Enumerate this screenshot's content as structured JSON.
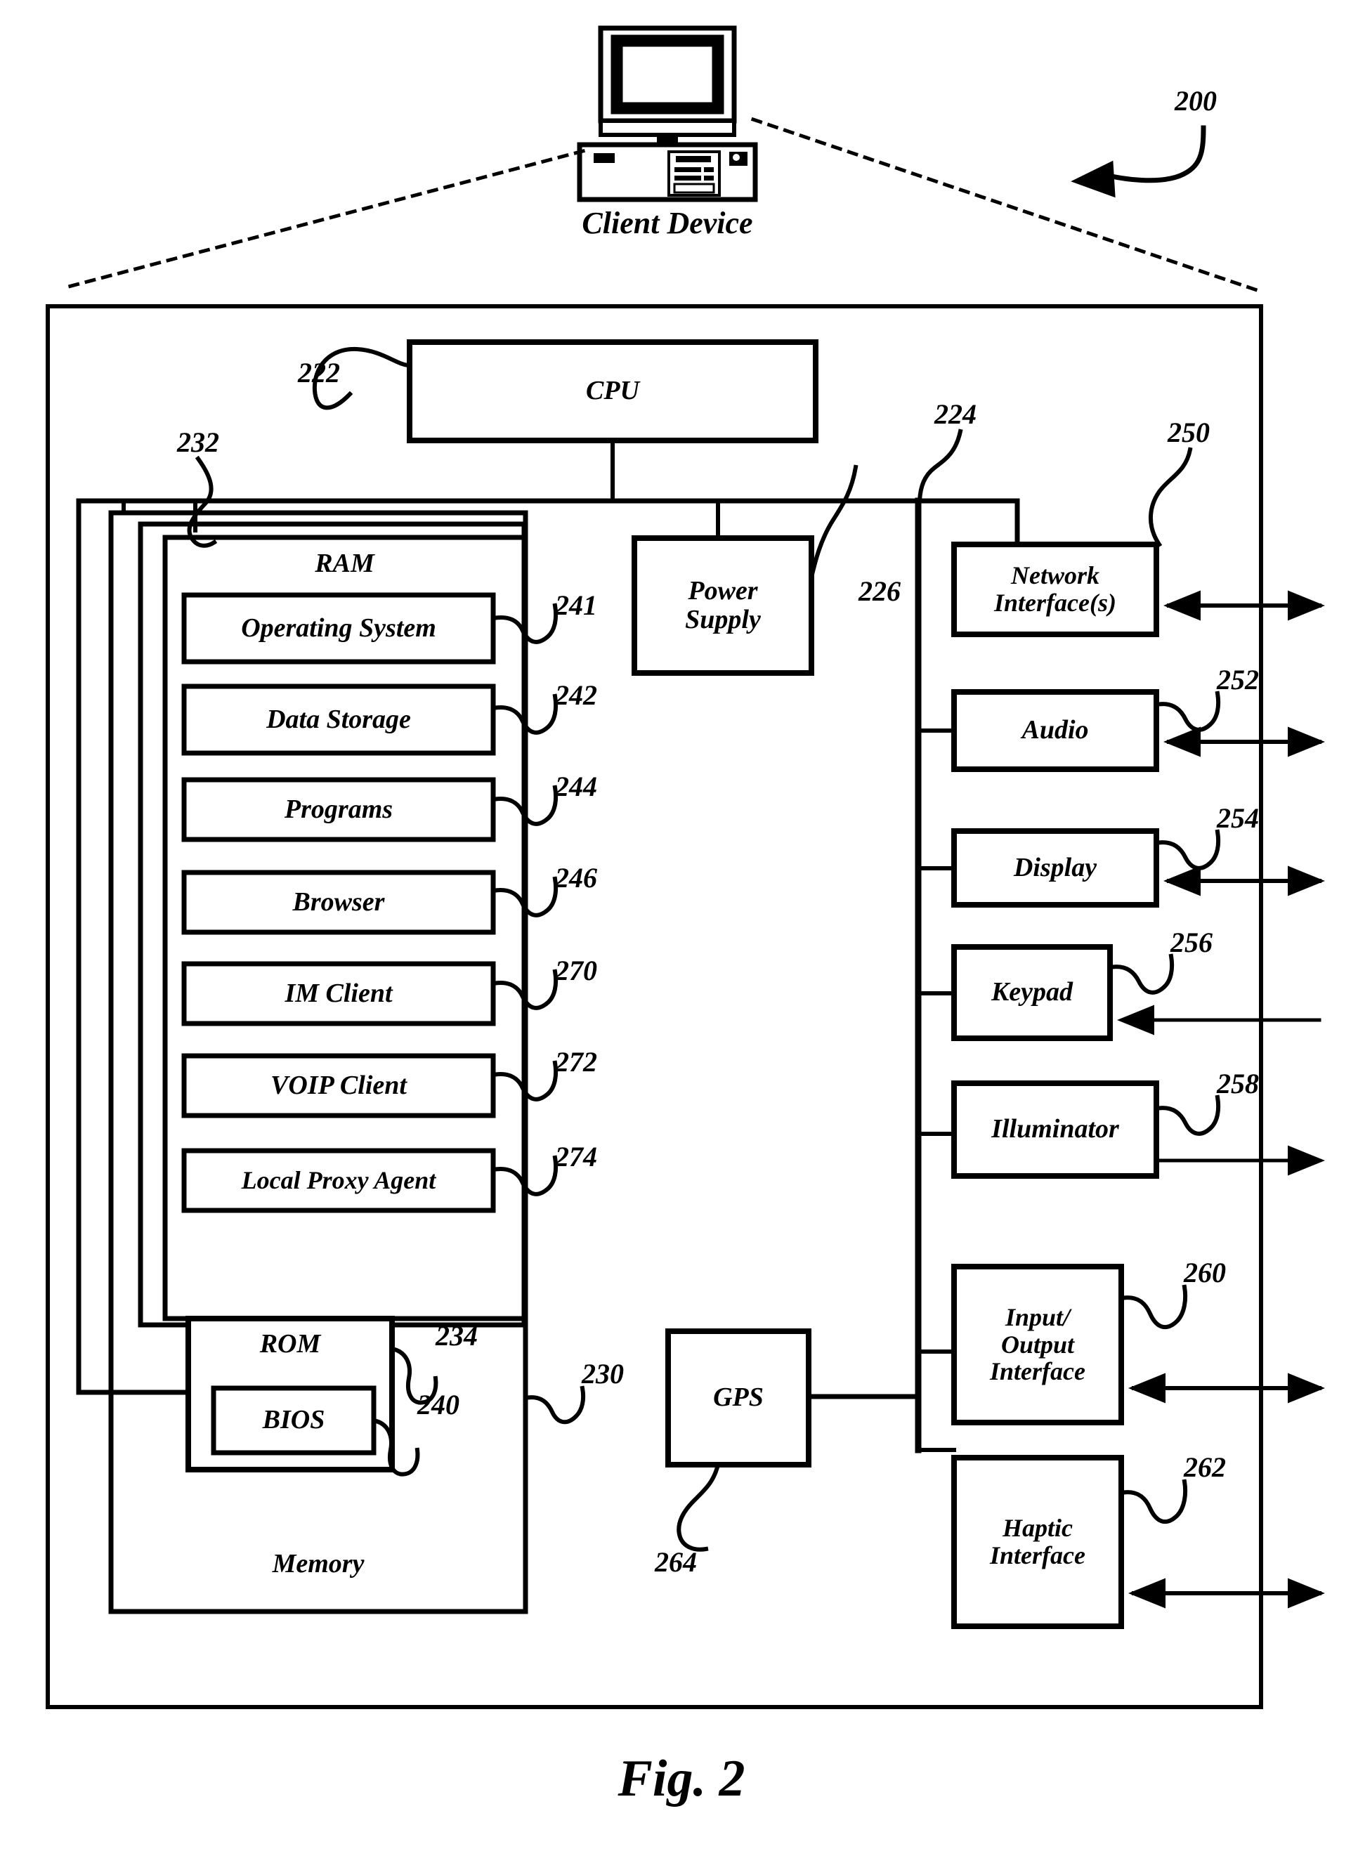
{
  "figure": {
    "caption": "Fig. 2",
    "top_label": "Client Device",
    "system_ref": "200"
  },
  "outer_frame": {
    "ref": "200"
  },
  "blocks": [
    {
      "id": "cpu",
      "label": "CPU",
      "ref": "222"
    },
    {
      "id": "memory",
      "label": "Memory",
      "ref": "230"
    },
    {
      "id": "ram",
      "label": "RAM",
      "ref": "232"
    },
    {
      "id": "os",
      "label": "Operating System",
      "ref": "241"
    },
    {
      "id": "datastore",
      "label": "Data Storage",
      "ref": "242"
    },
    {
      "id": "programs",
      "label": "Programs",
      "ref": "244"
    },
    {
      "id": "browser",
      "label": "Browser",
      "ref": "246"
    },
    {
      "id": "imclient",
      "label": "IM Client",
      "ref": "270"
    },
    {
      "id": "voipclient",
      "label": "VOIP  Client",
      "ref": "272"
    },
    {
      "id": "proxyagent",
      "label": "Local Proxy Agent",
      "ref": "274"
    },
    {
      "id": "rom",
      "label": "ROM",
      "ref": "234"
    },
    {
      "id": "bios",
      "label": "BIOS",
      "ref": "240"
    },
    {
      "id": "power",
      "label": "Power\nSupply",
      "ref": "226"
    },
    {
      "id": "gps",
      "label": "GPS",
      "ref": "264"
    },
    {
      "id": "netif",
      "label": "Network\nInterface(s)",
      "ref": "250"
    },
    {
      "id": "audio",
      "label": "Audio",
      "ref": "252"
    },
    {
      "id": "display",
      "label": "Display",
      "ref": "254"
    },
    {
      "id": "keypad",
      "label": "Keypad",
      "ref": "256"
    },
    {
      "id": "illum",
      "label": "Illuminator",
      "ref": "258"
    },
    {
      "id": "io",
      "label": "Input/\nOutput\nInterface",
      "ref": "260"
    },
    {
      "id": "haptic",
      "label": "Haptic\nInterface",
      "ref": "262"
    }
  ],
  "bus": {
    "ref": "224"
  },
  "colors": {
    "ink": "#000000",
    "paper": "#ffffff"
  }
}
